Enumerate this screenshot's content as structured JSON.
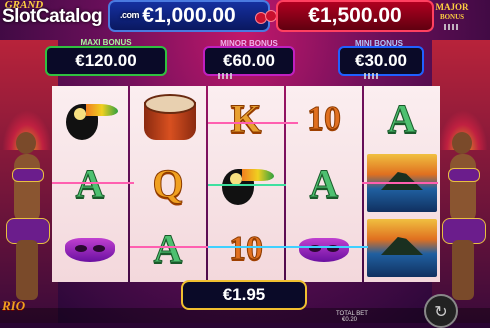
{
  "watermark": {
    "text_slot": "Slot",
    "text_catalog": "Catalog",
    "text_com": ".com"
  },
  "jackpots": {
    "grand": {
      "label_line1": "GRAND",
      "value": "€1,000.00"
    },
    "major": {
      "label_line1": "MAJOR",
      "label_line2": "BONUS",
      "value": "€1,500.00"
    },
    "maxi": {
      "title": "MAXI BONUS",
      "value": "€120.00"
    },
    "minor": {
      "title": "MINOR BONUS",
      "value": "€60.00"
    },
    "mini": {
      "title": "MINI BONUS",
      "value": "€30.00"
    }
  },
  "reels": [
    [
      "toucan",
      "A",
      "mask"
    ],
    [
      "drum",
      "Q",
      "A"
    ],
    [
      "K",
      "toucan",
      "10"
    ],
    [
      "10",
      "A",
      "mask"
    ],
    [
      "A",
      "scene",
      "scene"
    ]
  ],
  "letters": {
    "A": "A",
    "Q": "Q",
    "K": "K",
    "ten": "10"
  },
  "win": {
    "value": "€1.95"
  },
  "footer": {
    "logo": "RIO",
    "total_bet_label": "TOTAL BET",
    "total_bet_value": "€0.20"
  },
  "icons": {
    "spin": "refresh-icon"
  },
  "colors": {
    "grand": "#1530a0",
    "major": "#b00020",
    "maxi": "#30c040",
    "minor": "#c020c0",
    "mini": "#2060ff",
    "win_border": "#f0c030"
  }
}
